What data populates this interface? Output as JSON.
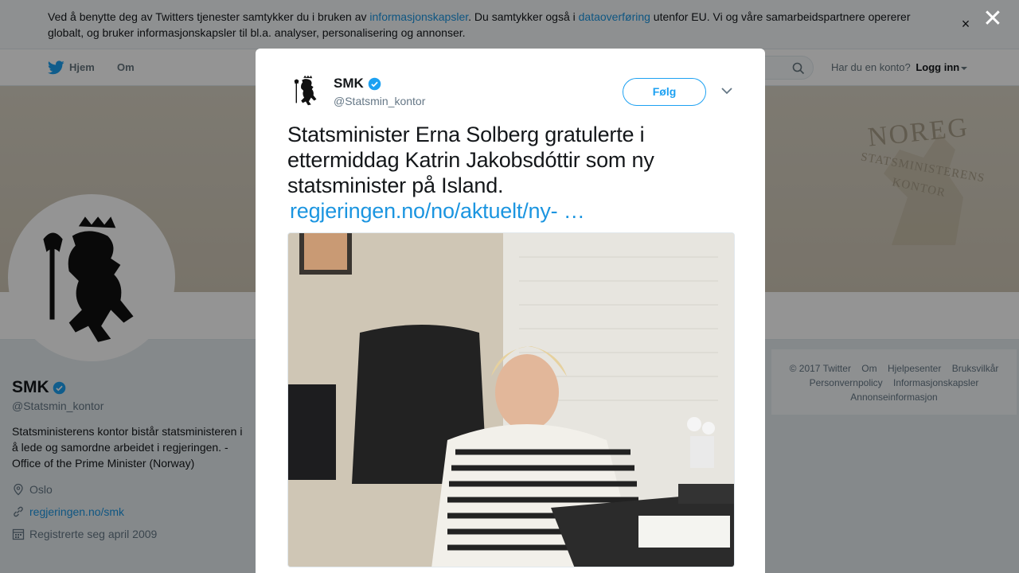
{
  "cookie": {
    "text_1": "Ved å benytte deg av Twitters tjenester samtykker du i bruken av ",
    "link_1": "informasjonskapsler",
    "text_2": ". Du samtykker også i ",
    "link_2": "dataoverføring",
    "text_3": " utenfor EU. Vi og våre samarbeidspartnere opererer globalt, og bruker informasjonskapsler til bl.a. analyser, personalisering og annonser.",
    "close_icon": "×"
  },
  "nav": {
    "home_label": "Hjem",
    "about_label": "Om",
    "login_prompt": "Har du en konto?",
    "login_label": "Logg inn"
  },
  "banner": {
    "line1": "NOREG",
    "line2": "STATSMINISTERENS",
    "line3": "KONTOR"
  },
  "profile": {
    "name": "SMK",
    "handle": "@Statsmin_kontor",
    "bio": "Statsministerens kontor bistår statsministeren i å lede og samordne arbeidet i regjeringen. - Office of the Prime Minister (Norway)",
    "location": "Oslo",
    "url": "regjeringen.no/smk",
    "joined": "Registrerte seg april 2009"
  },
  "footer": {
    "copyright": "© 2017 Twitter",
    "about": "Om",
    "help": "Hjelpesenter",
    "terms": "Bruksvilkår",
    "privacy": "Personvernpolicy",
    "cookies": "Informasjonskapsler",
    "ads": "Annonseinformasjon"
  },
  "overlay": {
    "close_icon": "✕"
  },
  "tweet": {
    "author_name": "SMK",
    "author_handle": "@Statsmin_kontor",
    "follow_label": "Følg",
    "text": "Statsminister Erna Solberg gratulerte i ettermiddag Katrin Jakobsdóttir som ny statsminister på Island.",
    "link": "regjeringen.no/no/aktuelt/ny- …"
  },
  "colors": {
    "accent": "#1da1f2",
    "link": "#1b95e0",
    "verified": "#1da1f2"
  },
  "icons": {
    "twitter": "twitter-bird-icon",
    "search": "search-icon",
    "verified": "verified-badge-icon",
    "location": "location-pin-icon",
    "link": "link-icon",
    "calendar": "calendar-icon",
    "chevron": "chevron-down-icon",
    "close": "close-icon"
  }
}
